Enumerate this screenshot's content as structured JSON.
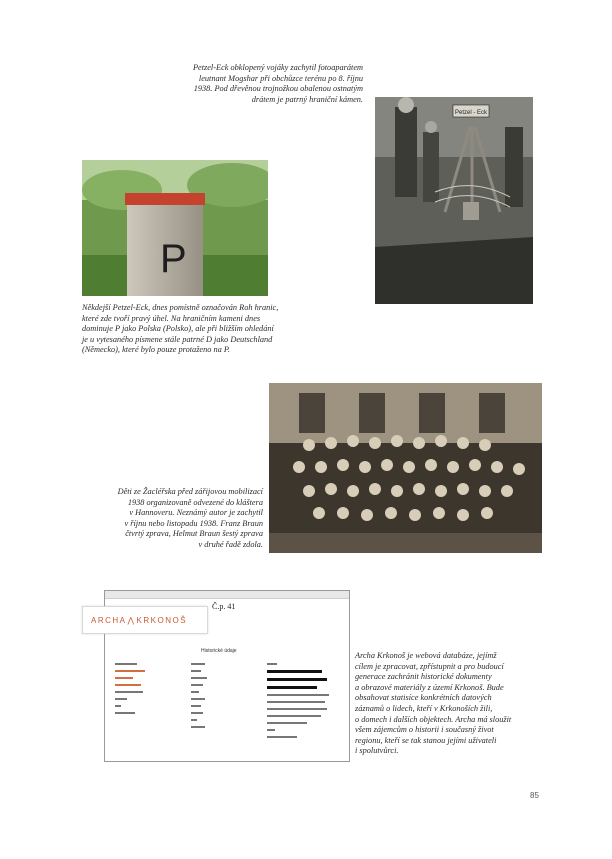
{
  "captions": {
    "soldiers": [
      "Petzel-Eck obklopený vojáky zachytil fotoaparátem",
      "leutnant Mogshar při obchůzce terénu po 8. říjnu",
      "1938. Pod dřevěnou trojnožkou obalenou ostnatým",
      "drátem je patrný hraniční kámen."
    ],
    "stone": [
      "Někdejší Petzel-Eck, dnes pomístně označován Roh hranic,",
      "které zde tvoří pravý úhel. Na hraničním kameni dnes",
      "dominuje P jako Polska (Polsko), ale při bližším ohledání",
      "je u vytesaného písmene stále patrné D jako Deutschland",
      "(Německo), které bylo pouze protaženo na P."
    ],
    "children": [
      "Děti ze Žacléřska před zářijovou mobilizací",
      "1938 organizovaně odvezené do kláštera",
      "v Hannoveru. Neznámý autor je zachytil",
      "v říjnu nebo listopadu 1938. Franz Braun",
      "čtvrtý zprava, Helmut Braun šestý zprava",
      "v druhé řadě zdola."
    ],
    "archa": [
      "Archa Krkonoš je webová databáze, jejímž",
      "cílem je zpracovat, zpřístupnit a pro budoucí",
      "generace zachránit historické dokumenty",
      "a obrazové materiály z území Krkonoš. Bude",
      "obsahovat statisíce konkrétních datových",
      "záznamů o lidech, kteří v Krkonoších žili,",
      "o domech i dalších objektech. Archa má sloužit",
      "všem zájemcům o historii i současný život",
      "regionu, kteří se tak stanou jejími uživateli",
      "i spolutvůrci."
    ]
  },
  "photos": {
    "soldiers_sign": "Petzel - Eck",
    "stone_letter": "P"
  },
  "database": {
    "logo_left": "ARCHA",
    "logo_right": "KRKONOŠ",
    "record_title": "Č.p. 41",
    "heading": "Historické údaje"
  },
  "page_number": "85",
  "colors": {
    "brand": "#c95a2e",
    "text": "#2b2b2b"
  }
}
